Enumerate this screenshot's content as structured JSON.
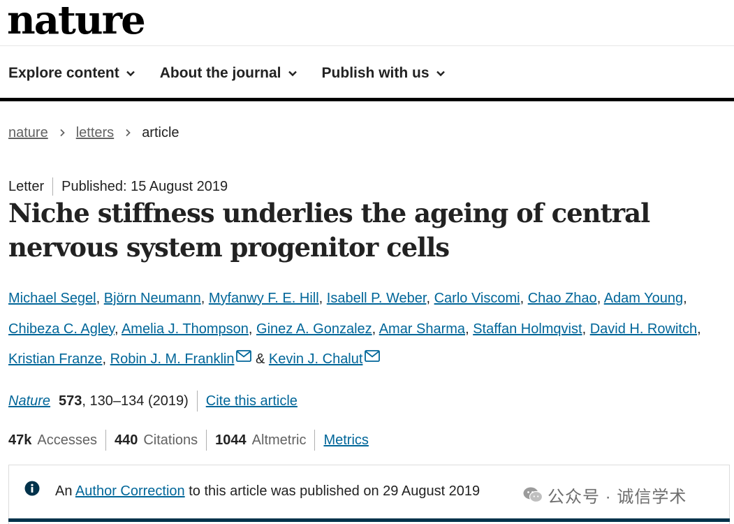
{
  "header": {
    "logo": "nature",
    "nav": [
      {
        "label": "Explore content"
      },
      {
        "label": "About the journal"
      },
      {
        "label": "Publish with us"
      }
    ]
  },
  "breadcrumb": {
    "items": [
      "nature",
      "letters"
    ],
    "current": "article"
  },
  "article": {
    "type": "Letter",
    "published": "Published: 15 August 2019",
    "title": "Niche stiffness underlies the ageing of central nervous system progenitor cells",
    "authors": [
      "Michael Segel",
      "Björn Neumann",
      "Myfanwy F. E. Hill",
      "Isabell P. Weber",
      "Carlo Viscomi",
      "Chao Zhao",
      "Adam Young",
      "Chibeza C. Agley",
      "Amelia J. Thompson",
      "Ginez A. Gonzalez",
      "Amar Sharma",
      "Staffan Holmqvist",
      "David H. Rowitch",
      "Kristian Franze",
      "Robin J. M. Franklin",
      "Kevin J. Chalut"
    ],
    "author_separator": ", ",
    "author_and": " & ",
    "citation": {
      "journal": "Nature",
      "volume": "573",
      "pages_year": ", 130–134 (2019)",
      "cite_link": "Cite this article"
    },
    "metrics": {
      "accesses_value": "47k",
      "accesses_label": "Accesses",
      "citations_value": "440",
      "citations_label": "Citations",
      "altmetric_value": "1044",
      "altmetric_label": "Altmetric",
      "metrics_link": "Metrics"
    },
    "notice": {
      "prefix": "An ",
      "link": "Author Correction",
      "suffix": " to this article was published on 29 August 2019"
    }
  },
  "watermark": {
    "text": "公众号 · 诚信学术",
    "icon": "wechat-icon"
  },
  "colors": {
    "link": "#006699",
    "text": "#222222",
    "muted": "#626262",
    "notice_bar": "#01324b",
    "info_icon": "#01324b"
  }
}
